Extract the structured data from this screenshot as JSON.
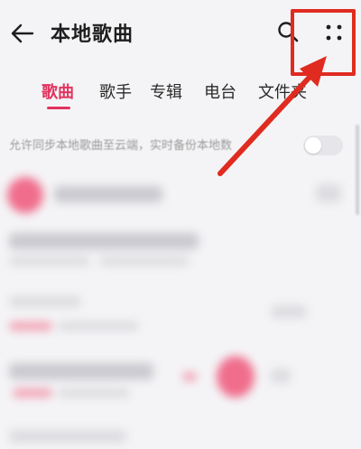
{
  "header": {
    "title": "本地歌曲",
    "back_icon": "back-arrow-icon",
    "search_icon": "search-icon",
    "more_icon": "more-dots-icon"
  },
  "tabs": [
    {
      "label": "歌曲",
      "active": true
    },
    {
      "label": "歌手",
      "active": false
    },
    {
      "label": "专辑",
      "active": false
    },
    {
      "label": "电台",
      "active": false
    },
    {
      "label": "文件夹",
      "active": false
    }
  ],
  "sync": {
    "text": "允许同步本地歌曲至云端，实时备份本地数",
    "enabled": false
  },
  "colors": {
    "accent": "#e2335f",
    "annotation": "#e02b20"
  }
}
